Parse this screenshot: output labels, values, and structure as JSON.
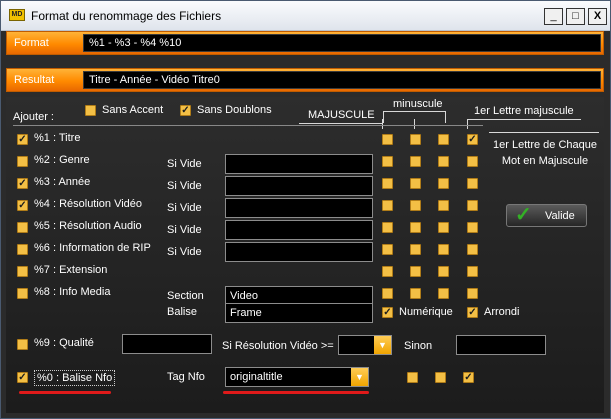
{
  "window": {
    "title": "Format du renommage des Fichiers",
    "app_icon_text": "MD",
    "minimize": "_",
    "maximize": "□",
    "close": "X"
  },
  "format": {
    "label": "Format",
    "value": "%1 - %3 - %4 %10"
  },
  "result": {
    "label": "Resultat",
    "value": "Titre - Année - Vidéo Titre0"
  },
  "options": {
    "ajouter_label": "Ajouter :",
    "sans_accent": {
      "label": "Sans Accent",
      "checked": false
    },
    "sans_doublons": {
      "label": "Sans Doublons",
      "checked": true
    },
    "case_headers": {
      "majuscule": "MAJUSCULE",
      "minuscule": "minuscule",
      "first_upper": "1er Lettre majuscule",
      "each_word": "1er Lettre de Chaque Mot en Majuscule"
    }
  },
  "fields": [
    {
      "code": "%1 : Titre",
      "checked": true,
      "si_vide": "",
      "value": "",
      "case": [
        false,
        false,
        false,
        true
      ]
    },
    {
      "code": "%2 : Genre",
      "checked": false,
      "si_vide": "Si Vide",
      "value": "",
      "case": [
        false,
        false,
        false,
        false
      ]
    },
    {
      "code": "%3 : Année",
      "checked": true,
      "si_vide": "Si Vide",
      "value": "",
      "case": [
        false,
        false,
        false,
        false
      ]
    },
    {
      "code": "%4 : Résolution Vidéo",
      "checked": true,
      "si_vide": "Si Vide",
      "value": "",
      "case": [
        false,
        false,
        false,
        false
      ]
    },
    {
      "code": "%5 : Résolution Audio",
      "checked": false,
      "si_vide": "Si Vide",
      "value": "",
      "case": [
        false,
        false,
        false,
        false
      ]
    },
    {
      "code": "%6 : Information de RIP",
      "checked": false,
      "si_vide": "Si Vide",
      "value": "",
      "case": [
        false,
        false,
        false,
        false
      ]
    },
    {
      "code": "%7 : Extension",
      "checked": false,
      "si_vide": "",
      "value": "",
      "case": [
        false,
        false,
        false,
        false
      ]
    },
    {
      "code": "%8 : Info Media",
      "checked": false,
      "si_vide": "Section",
      "value": "Video",
      "case": [
        false,
        false,
        false,
        false
      ]
    }
  ],
  "balise": {
    "label": "Balise",
    "value": "Frame",
    "numerique": {
      "label": "Numérique",
      "checked": true
    },
    "arrondi": {
      "label": "Arrondi",
      "checked": true
    }
  },
  "qualite": {
    "code": "%9 : Qualité",
    "checked": false,
    "value": "",
    "si_resolution_label": "Si Résolution Vidéo >=",
    "resolution_value": "",
    "sinon_label": "Sinon",
    "sinon_value": ""
  },
  "balise_nfo": {
    "code": "%0 : Balise Nfo",
    "checked": true,
    "tag_label": "Tag Nfo",
    "tag_value": "originaltitle",
    "case": [
      false,
      false,
      true
    ]
  },
  "valide_button": {
    "label": "Valide"
  },
  "accent_color": "#f3bf45",
  "highlight_color": "#e01a1a"
}
